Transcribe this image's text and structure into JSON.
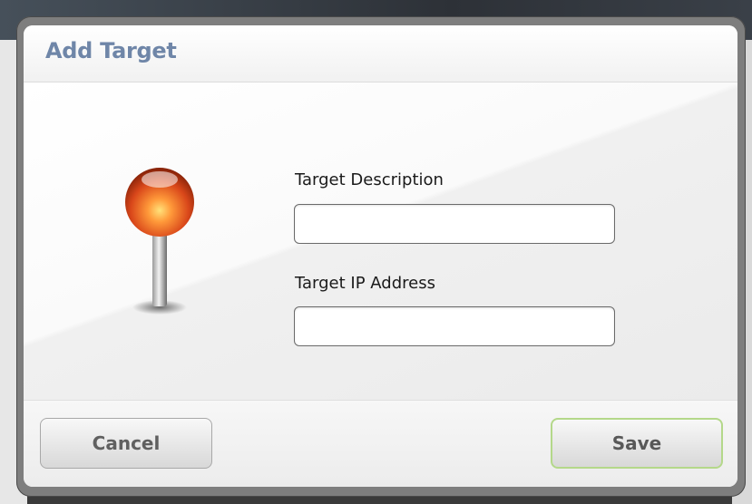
{
  "dialog": {
    "title": "Add Target",
    "icon": "map-pin-icon"
  },
  "form": {
    "description_label": "Target Description",
    "description_value": "",
    "ip_label": "Target IP Address",
    "ip_value": ""
  },
  "buttons": {
    "cancel_label": "Cancel",
    "save_label": "Save"
  },
  "colors": {
    "title": "#6f86a8",
    "save_border": "#b4d88a",
    "pin_head": "#e35a1b"
  }
}
